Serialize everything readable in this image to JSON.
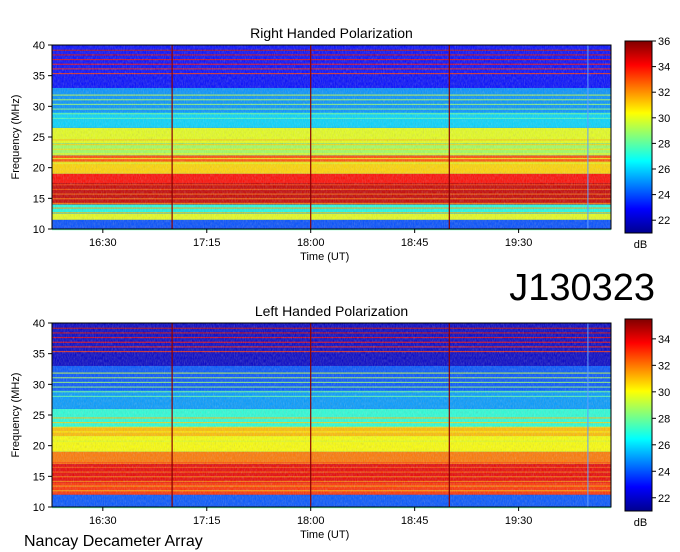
{
  "chart_data": [
    {
      "type": "heatmap",
      "title": "Right Handed Polarization",
      "xlabel": "Time (UT)",
      "ylabel": "Frequency (MHz)",
      "x_ticks": [
        "16:30",
        "17:15",
        "18:00",
        "18:45",
        "19:30"
      ],
      "y_ticks": [
        10,
        15,
        20,
        25,
        30,
        35,
        40
      ],
      "ylim": [
        10,
        40
      ],
      "colorbar": {
        "label": "dB",
        "ticks": [
          22,
          24,
          26,
          28,
          30,
          32,
          34,
          36
        ],
        "range": [
          21,
          36
        ]
      },
      "hour_markers": [
        "17:00",
        "18:00",
        "19:00"
      ],
      "bands": [
        {
          "f0": 10.0,
          "f1": 11.5,
          "level": 24
        },
        {
          "f0": 11.5,
          "f1": 12.5,
          "level": 30
        },
        {
          "f0": 12.5,
          "f1": 14.0,
          "level": 27
        },
        {
          "f0": 14.0,
          "f1": 17.5,
          "level": 35
        },
        {
          "f0": 17.5,
          "f1": 19.0,
          "level": 34
        },
        {
          "f0": 19.0,
          "f1": 21.0,
          "level": 31
        },
        {
          "f0": 21.0,
          "f1": 22.0,
          "level": 33
        },
        {
          "f0": 22.0,
          "f1": 24.0,
          "level": 29
        },
        {
          "f0": 24.0,
          "f1": 26.5,
          "level": 30
        },
        {
          "f0": 26.5,
          "f1": 29.0,
          "level": 26
        },
        {
          "f0": 29.0,
          "f1": 33.0,
          "level": 25
        },
        {
          "f0": 33.0,
          "f1": 40.0,
          "level": 23
        }
      ]
    },
    {
      "type": "heatmap",
      "title": "Left Handed Polarization",
      "xlabel": "Time (UT)",
      "ylabel": "Frequency (MHz)",
      "x_ticks": [
        "16:30",
        "17:15",
        "18:00",
        "18:45",
        "19:30"
      ],
      "y_ticks": [
        10,
        15,
        20,
        25,
        30,
        35,
        40
      ],
      "ylim": [
        10,
        40
      ],
      "colorbar": {
        "label": "dB",
        "ticks": [
          22,
          24,
          26,
          28,
          30,
          32,
          34
        ],
        "range": [
          21,
          35.5
        ]
      },
      "hour_markers": [
        "17:00",
        "18:00",
        "19:00"
      ],
      "bands": [
        {
          "f0": 10.0,
          "f1": 12.0,
          "level": 24
        },
        {
          "f0": 12.0,
          "f1": 14.0,
          "level": 33
        },
        {
          "f0": 14.0,
          "f1": 17.0,
          "level": 34
        },
        {
          "f0": 17.0,
          "f1": 19.0,
          "level": 32
        },
        {
          "f0": 19.0,
          "f1": 21.5,
          "level": 30
        },
        {
          "f0": 21.5,
          "f1": 23.0,
          "level": 31
        },
        {
          "f0": 23.0,
          "f1": 26.0,
          "level": 27
        },
        {
          "f0": 26.0,
          "f1": 29.0,
          "level": 25
        },
        {
          "f0": 29.0,
          "f1": 33.0,
          "level": 24
        },
        {
          "f0": 33.0,
          "f1": 40.0,
          "level": 22
        }
      ]
    }
  ],
  "observation_id": "J130323",
  "instrument": "Nancay Decameter Array"
}
